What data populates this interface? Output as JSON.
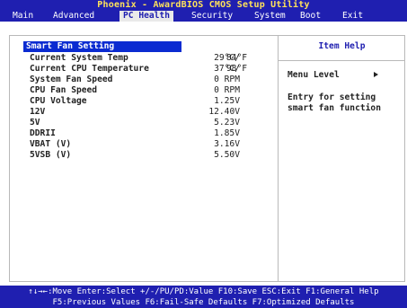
{
  "title": "Phoenix - AwardBIOS CMOS Setup Utility",
  "menu": [
    {
      "label": "Main"
    },
    {
      "label": "Advanced"
    },
    {
      "label": "PC Health"
    },
    {
      "label": "Security"
    },
    {
      "label": "System"
    },
    {
      "label": "Boot"
    },
    {
      "label": "Exit"
    }
  ],
  "active_menu": "PC Health",
  "items": [
    {
      "label": "Smart Fan Setting",
      "value": "",
      "value2": ""
    },
    {
      "label": "Current System Temp",
      "value": "29°C/",
      "value2": "84°F"
    },
    {
      "label": "Current CPU Temperature",
      "value": "37°C/",
      "value2": "98°F"
    },
    {
      "label": "System Fan Speed",
      "value": "0 RPM",
      "value2": ""
    },
    {
      "label": "CPU Fan Speed",
      "value": "0 RPM",
      "value2": ""
    },
    {
      "label": "CPU Voltage",
      "value": "1.25V",
      "value2": ""
    },
    {
      "label": "12V",
      "value": "12.40V",
      "value2": ""
    },
    {
      "label": "5V",
      "value": "5.23V",
      "value2": ""
    },
    {
      "label": "DDRII",
      "value": "1.85V",
      "value2": ""
    },
    {
      "label": "VBAT (V)",
      "value": "3.16V",
      "value2": ""
    },
    {
      "label": "5VSB (V)",
      "value": "5.50V",
      "value2": ""
    }
  ],
  "help": {
    "title": "Item Help",
    "menu_level": "Menu Level",
    "lines": [
      "Entry for setting",
      "smart fan function"
    ]
  },
  "footer": {
    "line1": "↑↓→←:Move  Enter:Select  +/-/PU/PD:Value  F10:Save  ESC:Exit  F1:General Help",
    "line2": "F5:Previous Values   F6:Fail-Safe Defaults   F7:Optimized Defaults"
  },
  "colors": {
    "bios_blue": "#1f1fb0",
    "title_yellow": "#ffe25a",
    "selection_blue": "#0b2bd1",
    "panel_gray": "#b9b9b9"
  }
}
